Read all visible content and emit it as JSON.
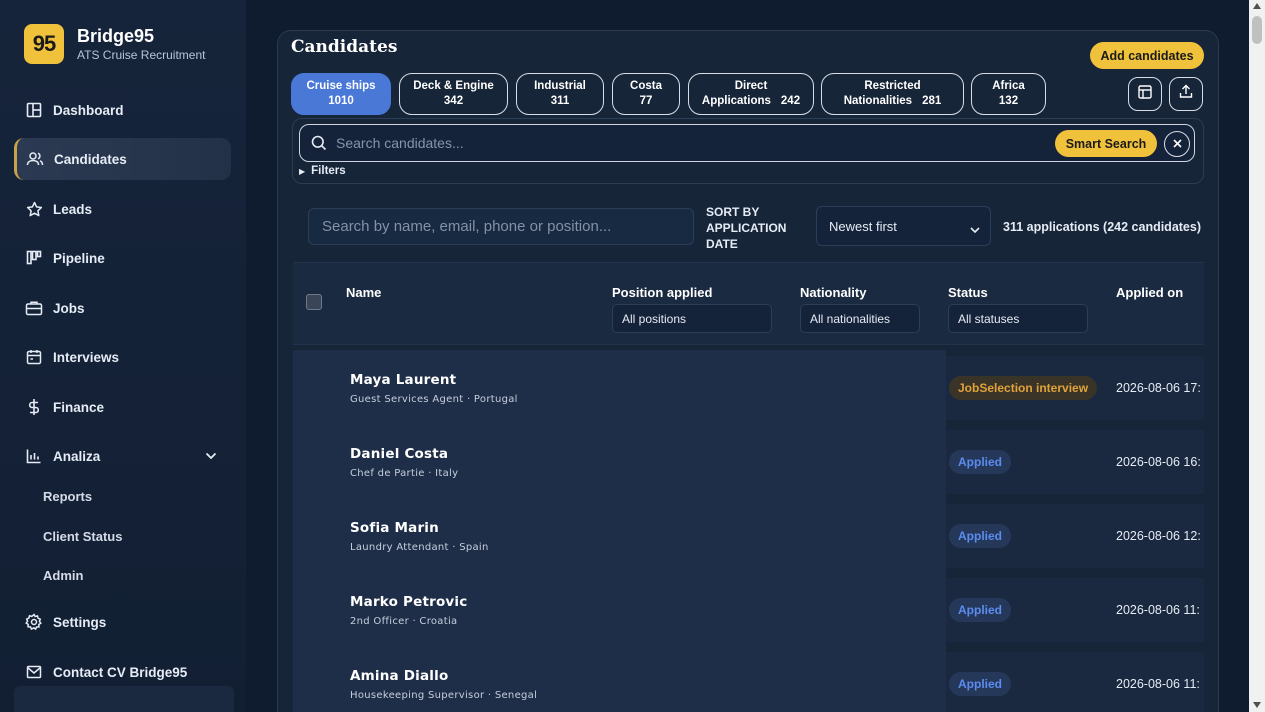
{
  "brand": {
    "logo": "95",
    "name": "Bridge95",
    "subtitle": "ATS Cruise Recruitment"
  },
  "nav": {
    "dashboard": "Dashboard",
    "candidates": "Candidates",
    "leads": "Leads",
    "pipeline": "Pipeline",
    "jobs": "Jobs",
    "interviews": "Interviews",
    "finance": "Finance",
    "analiza": "Analiza",
    "reports": "Reports",
    "client_status": "Client Status",
    "admin": "Admin",
    "settings": "Settings",
    "contact": "Contact CV Bridge95"
  },
  "page": {
    "title": "Candidates",
    "add_label": "Add candidates"
  },
  "tabs": [
    {
      "line1": "Cruise ships",
      "line2": "",
      "count": "1010"
    },
    {
      "line1": "Deck & Engine",
      "line2": "",
      "count": "342"
    },
    {
      "line1": "Industrial",
      "line2": "",
      "count": "311"
    },
    {
      "line1": "Costa",
      "line2": "",
      "count": "77"
    },
    {
      "line1": "Direct",
      "line2": "Applications",
      "count": "242"
    },
    {
      "line1": "Restricted",
      "line2": "Nationalities",
      "count": "281"
    },
    {
      "line1": "Africa",
      "line2": "",
      "count": "132"
    }
  ],
  "search": {
    "placeholder": "Search candidates...",
    "smart_label": "Smart Search",
    "filters_label": "Filters"
  },
  "list": {
    "name_search_placeholder": "Search by name, email, phone or position...",
    "sort_label": "SORT BY APPLICATION DATE",
    "sort_value": "Newest first",
    "count_text": "311 applications (242 candidates)"
  },
  "table": {
    "headers": {
      "name": "Name",
      "position": "Position applied",
      "nationality": "Nationality",
      "status": "Status",
      "applied": "Applied on"
    },
    "filters": {
      "position": "All positions",
      "nationality": "All nationalities",
      "status": "All statuses"
    },
    "rows": [
      {
        "name": "Maya Laurent",
        "sub": "Guest Services Agent · Portugal",
        "status": "JobSelection interview",
        "date": "2026-08-06 17:"
      },
      {
        "name": "Daniel Costa",
        "sub": "Chef de Partie · Italy",
        "status": "Applied",
        "date": "2026-08-06 16:"
      },
      {
        "name": "Sofia Marin",
        "sub": "Laundry Attendant · Spain",
        "status": "Applied",
        "date": "2026-08-06 12:"
      },
      {
        "name": "Marko Petrovic",
        "sub": "2nd Officer · Croatia",
        "status": "Applied",
        "date": "2026-08-06 11:"
      },
      {
        "name": "Amina Diallo",
        "sub": "Housekeeping Supervisor · Senegal",
        "status": "Applied",
        "date": "2026-08-06 11:"
      }
    ]
  },
  "colors": {
    "accent": "#f0c23b",
    "active_tab": "#4a78d6",
    "applied": "#5b8cf0",
    "interview": "#e0a23a"
  }
}
